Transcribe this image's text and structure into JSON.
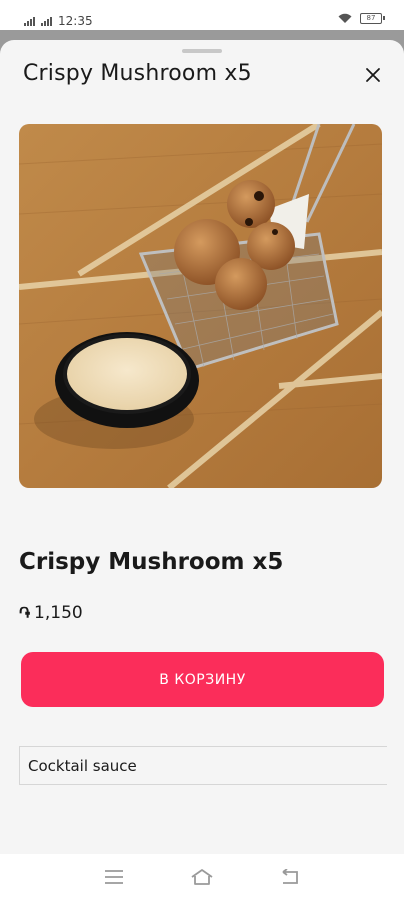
{
  "status_bar": {
    "time": "12:35",
    "battery": "87",
    "left_icons": [
      "signal-icon",
      "signal-icon"
    ],
    "right_icons": [
      "wifi-icon",
      "battery-icon"
    ]
  },
  "sheet": {
    "title": "Crispy Mushroom x5",
    "close_icon": "close-icon"
  },
  "product": {
    "name": "Crispy Mushroom x5",
    "currency_symbol": "֏",
    "price": "1,150",
    "image_alt": "crispy mushrooms in wire basket with dipping sauce"
  },
  "actions": {
    "add_to_cart_label": "В КОРЗИНУ"
  },
  "options": [
    {
      "label": "Cocktail sauce"
    }
  ],
  "nav": {
    "icons": [
      "menu-icon",
      "home-icon",
      "back-icon"
    ]
  },
  "colors": {
    "accent": "#fb2d5a",
    "sheet_bg": "#f5f5f5",
    "backdrop": "#9a9a9a"
  }
}
